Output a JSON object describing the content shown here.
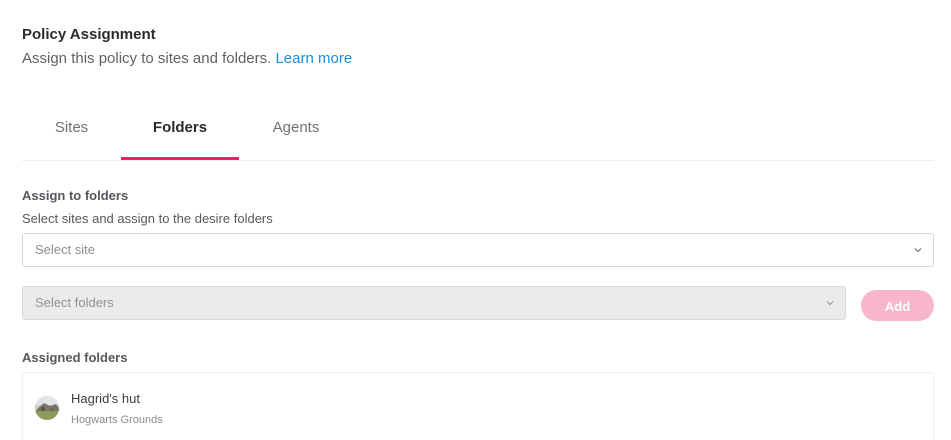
{
  "header": {
    "title": "Policy Assignment",
    "subtitle": "Assign this policy to sites and folders. ",
    "learn_more": "Learn more"
  },
  "tabs": [
    {
      "label": "Sites",
      "active": false
    },
    {
      "label": "Folders",
      "active": true
    },
    {
      "label": "Agents",
      "active": false
    }
  ],
  "assign": {
    "heading": "Assign to folders",
    "description": "Select sites and assign to the desire folders",
    "site_select": {
      "placeholder": "Select site",
      "icon": "chevron-down-icon"
    },
    "folders_select": {
      "placeholder": "Select folders",
      "disabled": true,
      "icon": "chevron-down-icon"
    },
    "add_button": "Add"
  },
  "assigned": {
    "heading": "Assigned folders",
    "items": [
      {
        "name": "Hagrid's hut",
        "site": "Hogwarts Grounds",
        "icon": "folder-thumbnail"
      }
    ]
  },
  "colors": {
    "accent": "#ef1f6a",
    "link": "#1a8fd9",
    "add_button_disabled": "#f7b6cc"
  }
}
